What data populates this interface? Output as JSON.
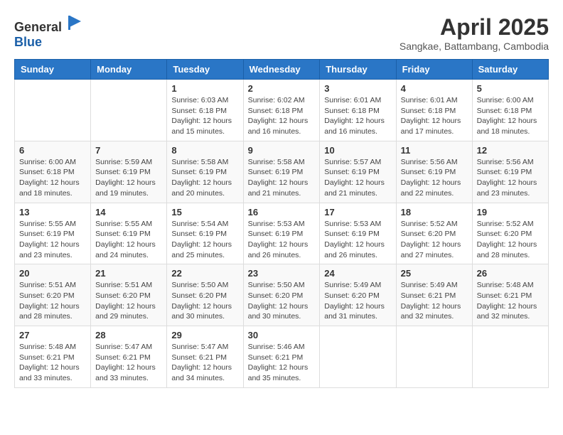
{
  "logo": {
    "general": "General",
    "blue": "Blue"
  },
  "title": "April 2025",
  "subtitle": "Sangkae, Battambang, Cambodia",
  "weekdays": [
    "Sunday",
    "Monday",
    "Tuesday",
    "Wednesday",
    "Thursday",
    "Friday",
    "Saturday"
  ],
  "weeks": [
    [
      {
        "day": "",
        "info": ""
      },
      {
        "day": "",
        "info": ""
      },
      {
        "day": "1",
        "info": "Sunrise: 6:03 AM\nSunset: 6:18 PM\nDaylight: 12 hours and 15 minutes."
      },
      {
        "day": "2",
        "info": "Sunrise: 6:02 AM\nSunset: 6:18 PM\nDaylight: 12 hours and 16 minutes."
      },
      {
        "day": "3",
        "info": "Sunrise: 6:01 AM\nSunset: 6:18 PM\nDaylight: 12 hours and 16 minutes."
      },
      {
        "day": "4",
        "info": "Sunrise: 6:01 AM\nSunset: 6:18 PM\nDaylight: 12 hours and 17 minutes."
      },
      {
        "day": "5",
        "info": "Sunrise: 6:00 AM\nSunset: 6:18 PM\nDaylight: 12 hours and 18 minutes."
      }
    ],
    [
      {
        "day": "6",
        "info": "Sunrise: 6:00 AM\nSunset: 6:18 PM\nDaylight: 12 hours and 18 minutes."
      },
      {
        "day": "7",
        "info": "Sunrise: 5:59 AM\nSunset: 6:19 PM\nDaylight: 12 hours and 19 minutes."
      },
      {
        "day": "8",
        "info": "Sunrise: 5:58 AM\nSunset: 6:19 PM\nDaylight: 12 hours and 20 minutes."
      },
      {
        "day": "9",
        "info": "Sunrise: 5:58 AM\nSunset: 6:19 PM\nDaylight: 12 hours and 21 minutes."
      },
      {
        "day": "10",
        "info": "Sunrise: 5:57 AM\nSunset: 6:19 PM\nDaylight: 12 hours and 21 minutes."
      },
      {
        "day": "11",
        "info": "Sunrise: 5:56 AM\nSunset: 6:19 PM\nDaylight: 12 hours and 22 minutes."
      },
      {
        "day": "12",
        "info": "Sunrise: 5:56 AM\nSunset: 6:19 PM\nDaylight: 12 hours and 23 minutes."
      }
    ],
    [
      {
        "day": "13",
        "info": "Sunrise: 5:55 AM\nSunset: 6:19 PM\nDaylight: 12 hours and 23 minutes."
      },
      {
        "day": "14",
        "info": "Sunrise: 5:55 AM\nSunset: 6:19 PM\nDaylight: 12 hours and 24 minutes."
      },
      {
        "day": "15",
        "info": "Sunrise: 5:54 AM\nSunset: 6:19 PM\nDaylight: 12 hours and 25 minutes."
      },
      {
        "day": "16",
        "info": "Sunrise: 5:53 AM\nSunset: 6:19 PM\nDaylight: 12 hours and 26 minutes."
      },
      {
        "day": "17",
        "info": "Sunrise: 5:53 AM\nSunset: 6:19 PM\nDaylight: 12 hours and 26 minutes."
      },
      {
        "day": "18",
        "info": "Sunrise: 5:52 AM\nSunset: 6:20 PM\nDaylight: 12 hours and 27 minutes."
      },
      {
        "day": "19",
        "info": "Sunrise: 5:52 AM\nSunset: 6:20 PM\nDaylight: 12 hours and 28 minutes."
      }
    ],
    [
      {
        "day": "20",
        "info": "Sunrise: 5:51 AM\nSunset: 6:20 PM\nDaylight: 12 hours and 28 minutes."
      },
      {
        "day": "21",
        "info": "Sunrise: 5:51 AM\nSunset: 6:20 PM\nDaylight: 12 hours and 29 minutes."
      },
      {
        "day": "22",
        "info": "Sunrise: 5:50 AM\nSunset: 6:20 PM\nDaylight: 12 hours and 30 minutes."
      },
      {
        "day": "23",
        "info": "Sunrise: 5:50 AM\nSunset: 6:20 PM\nDaylight: 12 hours and 30 minutes."
      },
      {
        "day": "24",
        "info": "Sunrise: 5:49 AM\nSunset: 6:20 PM\nDaylight: 12 hours and 31 minutes."
      },
      {
        "day": "25",
        "info": "Sunrise: 5:49 AM\nSunset: 6:21 PM\nDaylight: 12 hours and 32 minutes."
      },
      {
        "day": "26",
        "info": "Sunrise: 5:48 AM\nSunset: 6:21 PM\nDaylight: 12 hours and 32 minutes."
      }
    ],
    [
      {
        "day": "27",
        "info": "Sunrise: 5:48 AM\nSunset: 6:21 PM\nDaylight: 12 hours and 33 minutes."
      },
      {
        "day": "28",
        "info": "Sunrise: 5:47 AM\nSunset: 6:21 PM\nDaylight: 12 hours and 33 minutes."
      },
      {
        "day": "29",
        "info": "Sunrise: 5:47 AM\nSunset: 6:21 PM\nDaylight: 12 hours and 34 minutes."
      },
      {
        "day": "30",
        "info": "Sunrise: 5:46 AM\nSunset: 6:21 PM\nDaylight: 12 hours and 35 minutes."
      },
      {
        "day": "",
        "info": ""
      },
      {
        "day": "",
        "info": ""
      },
      {
        "day": "",
        "info": ""
      }
    ]
  ]
}
